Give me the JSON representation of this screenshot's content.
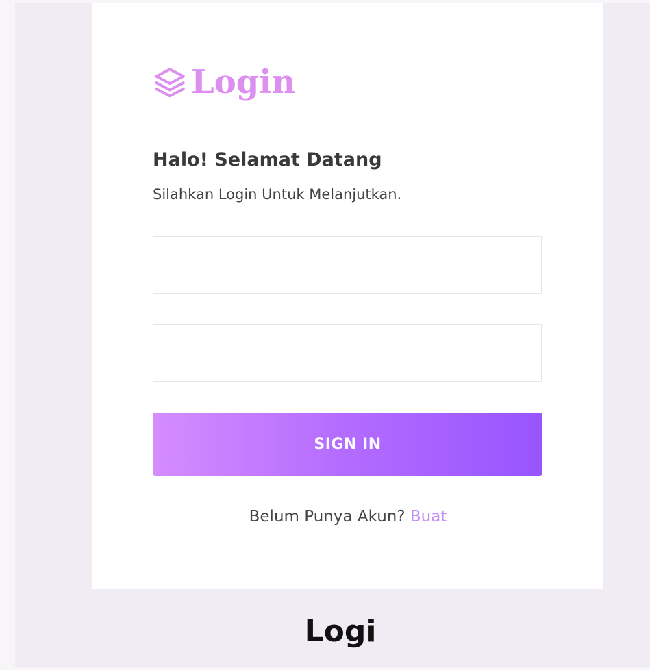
{
  "brand": {
    "icon": "layers-icon",
    "title": "Login"
  },
  "welcome": {
    "title": "Halo! Selamat Datang",
    "subtitle": "Silahkan Login Untuk Melanjutkan."
  },
  "form": {
    "username_value": "",
    "password_value": "",
    "submit_label": "SIGN IN"
  },
  "signup": {
    "prompt": "Belum Punya Akun?",
    "link_label": "Buat"
  },
  "caption": "Logi",
  "colors": {
    "accent": "#dd8ff0",
    "button_gradient_start": "#d58cff",
    "button_gradient_end": "#9855ff",
    "link": "#c58ef5",
    "background": "#f1ebf3"
  }
}
